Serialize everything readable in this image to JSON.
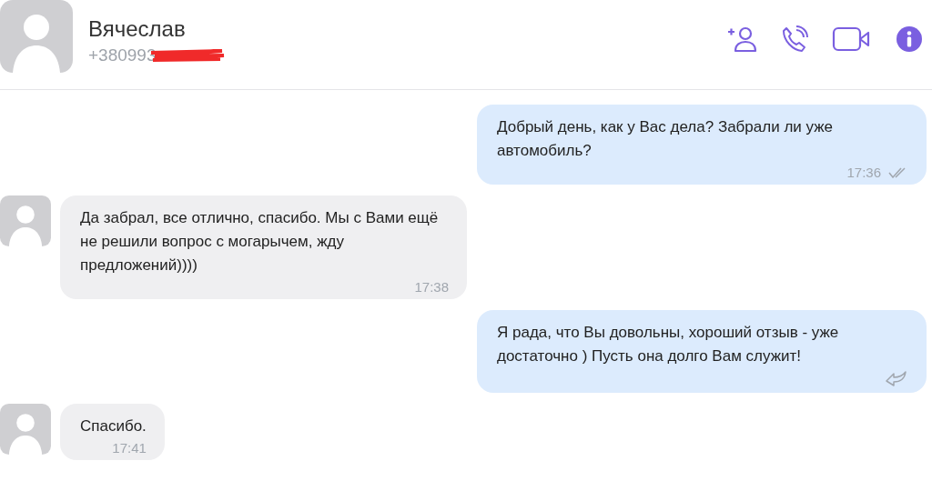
{
  "contact": {
    "name": "Вячеслав",
    "phone": "+380993"
  },
  "messages": [
    {
      "kind": "outgoing",
      "text": "Добрый день, как у Вас дела? Забрали ли уже автомобиль?",
      "time": "17:36",
      "read": true
    },
    {
      "kind": "incoming",
      "text": "Да забрал, все отлично, спасибо. Мы с Вами ещё не решили вопрос с могарычем, жду предложений))))",
      "time": "17:38"
    },
    {
      "kind": "outgoing",
      "text": "Я рада, что Вы довольны, хороший отзыв - уже достаточно ) Пусть она долго Вам служит!",
      "read": false
    },
    {
      "kind": "incoming",
      "text": "Спасибо.",
      "time": "17:41"
    }
  ]
}
